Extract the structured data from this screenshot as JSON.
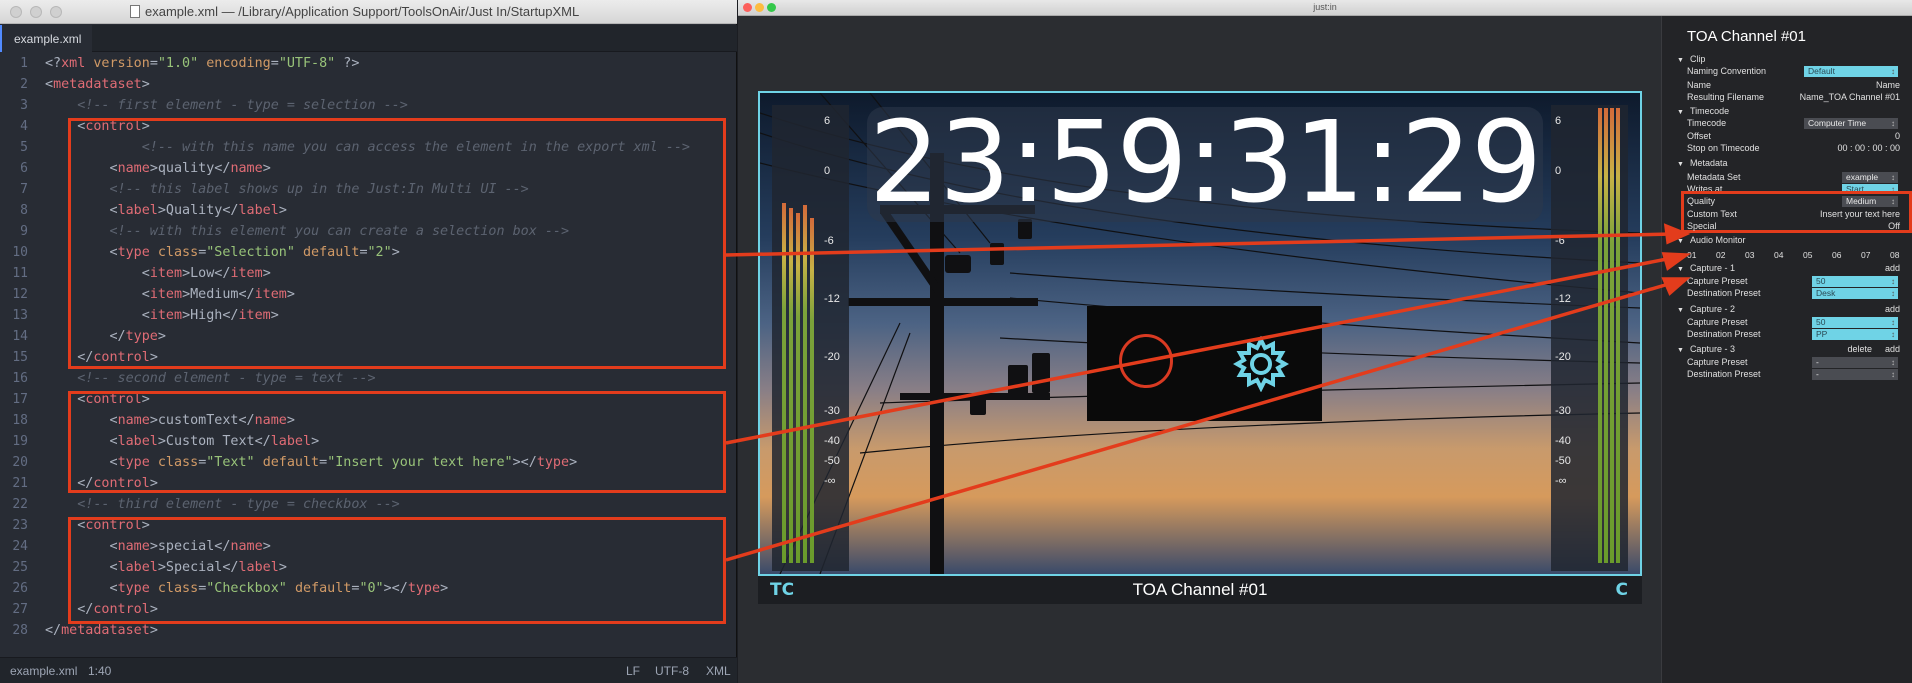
{
  "editor": {
    "window_title": "example.xml — /Library/Application Support/ToolsOnAir/Just In/StartupXML",
    "tab": "example.xml",
    "lines": [
      {
        "n": "1",
        "parts": [
          [
            "pn",
            "<?"
          ],
          [
            "tg",
            "xml"
          ],
          [
            "pn",
            " "
          ],
          [
            "at",
            "version"
          ],
          [
            "pn",
            "="
          ],
          [
            "st",
            "\"1.0\""
          ],
          [
            "pn",
            " "
          ],
          [
            "at",
            "encoding"
          ],
          [
            "pn",
            "="
          ],
          [
            "st",
            "\"UTF-8\""
          ],
          [
            "pn",
            " ?>"
          ]
        ]
      },
      {
        "n": "2",
        "parts": [
          [
            "pn",
            "<"
          ],
          [
            "tg",
            "metadataset"
          ],
          [
            "pn",
            ">"
          ]
        ]
      },
      {
        "n": "3",
        "parts": [
          [
            "cm",
            "    <!-- first element - type = selection -->"
          ]
        ]
      },
      {
        "n": "4",
        "parts": [
          [
            "pn",
            "    <"
          ],
          [
            "tg",
            "control"
          ],
          [
            "pn",
            ">"
          ]
        ]
      },
      {
        "n": "5",
        "parts": [
          [
            "cm",
            "            <!-- with this name you can access the element in the export xml -->"
          ]
        ]
      },
      {
        "n": "6",
        "parts": [
          [
            "pn",
            "        <"
          ],
          [
            "tg",
            "name"
          ],
          [
            "pn",
            ">quality</"
          ],
          [
            "tg",
            "name"
          ],
          [
            "pn",
            ">"
          ]
        ]
      },
      {
        "n": "7",
        "parts": [
          [
            "cm",
            "        <!-- this label shows up in the Just:In Multi UI -->"
          ]
        ]
      },
      {
        "n": "8",
        "parts": [
          [
            "pn",
            "        <"
          ],
          [
            "tg",
            "label"
          ],
          [
            "pn",
            ">Quality</"
          ],
          [
            "tg",
            "label"
          ],
          [
            "pn",
            ">"
          ]
        ]
      },
      {
        "n": "9",
        "parts": [
          [
            "cm",
            "        <!-- with this element you can create a selection box -->"
          ]
        ]
      },
      {
        "n": "10",
        "parts": [
          [
            "pn",
            "        <"
          ],
          [
            "tg",
            "type"
          ],
          [
            "pn",
            " "
          ],
          [
            "at",
            "class"
          ],
          [
            "pn",
            "="
          ],
          [
            "st",
            "\"Selection\""
          ],
          [
            "pn",
            " "
          ],
          [
            "at",
            "default"
          ],
          [
            "pn",
            "="
          ],
          [
            "st",
            "\"2\""
          ],
          [
            "pn",
            ">"
          ]
        ]
      },
      {
        "n": "11",
        "parts": [
          [
            "pn",
            "            <"
          ],
          [
            "tg",
            "item"
          ],
          [
            "pn",
            ">Low</"
          ],
          [
            "tg",
            "item"
          ],
          [
            "pn",
            ">"
          ]
        ]
      },
      {
        "n": "12",
        "parts": [
          [
            "pn",
            "            <"
          ],
          [
            "tg",
            "item"
          ],
          [
            "pn",
            ">Medium</"
          ],
          [
            "tg",
            "item"
          ],
          [
            "pn",
            ">"
          ]
        ]
      },
      {
        "n": "13",
        "parts": [
          [
            "pn",
            "            <"
          ],
          [
            "tg",
            "item"
          ],
          [
            "pn",
            ">High</"
          ],
          [
            "tg",
            "item"
          ],
          [
            "pn",
            ">"
          ]
        ]
      },
      {
        "n": "14",
        "parts": [
          [
            "pn",
            "        </"
          ],
          [
            "tg",
            "type"
          ],
          [
            "pn",
            ">"
          ]
        ]
      },
      {
        "n": "15",
        "parts": [
          [
            "pn",
            "    </"
          ],
          [
            "tg",
            "control"
          ],
          [
            "pn",
            ">"
          ]
        ]
      },
      {
        "n": "16",
        "parts": [
          [
            "cm",
            "    <!-- second element - type = text -->"
          ]
        ]
      },
      {
        "n": "17",
        "parts": [
          [
            "pn",
            "    <"
          ],
          [
            "tg",
            "control"
          ],
          [
            "pn",
            ">"
          ]
        ]
      },
      {
        "n": "18",
        "parts": [
          [
            "pn",
            "        <"
          ],
          [
            "tg",
            "name"
          ],
          [
            "pn",
            ">customText</"
          ],
          [
            "tg",
            "name"
          ],
          [
            "pn",
            ">"
          ]
        ]
      },
      {
        "n": "19",
        "parts": [
          [
            "pn",
            "        <"
          ],
          [
            "tg",
            "label"
          ],
          [
            "pn",
            ">Custom Text</"
          ],
          [
            "tg",
            "label"
          ],
          [
            "pn",
            ">"
          ]
        ]
      },
      {
        "n": "20",
        "parts": [
          [
            "pn",
            "        <"
          ],
          [
            "tg",
            "type"
          ],
          [
            "pn",
            " "
          ],
          [
            "at",
            "class"
          ],
          [
            "pn",
            "="
          ],
          [
            "st",
            "\"Text\""
          ],
          [
            "pn",
            " "
          ],
          [
            "at",
            "default"
          ],
          [
            "pn",
            "="
          ],
          [
            "st",
            "\"Insert your text here\""
          ],
          [
            "pn",
            "></"
          ],
          [
            "tg",
            "type"
          ],
          [
            "pn",
            ">"
          ]
        ]
      },
      {
        "n": "21",
        "parts": [
          [
            "pn",
            "    </"
          ],
          [
            "tg",
            "control"
          ],
          [
            "pn",
            ">"
          ]
        ]
      },
      {
        "n": "22",
        "parts": [
          [
            "cm",
            "    <!-- third element - type = checkbox -->"
          ]
        ]
      },
      {
        "n": "23",
        "parts": [
          [
            "pn",
            "    <"
          ],
          [
            "tg",
            "control"
          ],
          [
            "pn",
            ">"
          ]
        ]
      },
      {
        "n": "24",
        "parts": [
          [
            "pn",
            "        <"
          ],
          [
            "tg",
            "name"
          ],
          [
            "pn",
            ">special</"
          ],
          [
            "tg",
            "name"
          ],
          [
            "pn",
            ">"
          ]
        ]
      },
      {
        "n": "25",
        "parts": [
          [
            "pn",
            "        <"
          ],
          [
            "tg",
            "label"
          ],
          [
            "pn",
            ">Special</"
          ],
          [
            "tg",
            "label"
          ],
          [
            "pn",
            ">"
          ]
        ]
      },
      {
        "n": "26",
        "parts": [
          [
            "pn",
            "        <"
          ],
          [
            "tg",
            "type"
          ],
          [
            "pn",
            " "
          ],
          [
            "at",
            "class"
          ],
          [
            "pn",
            "="
          ],
          [
            "st",
            "\"Checkbox\""
          ],
          [
            "pn",
            " "
          ],
          [
            "at",
            "default"
          ],
          [
            "pn",
            "="
          ],
          [
            "st",
            "\"0\""
          ],
          [
            "pn",
            "></"
          ],
          [
            "tg",
            "type"
          ],
          [
            "pn",
            ">"
          ]
        ]
      },
      {
        "n": "27",
        "parts": [
          [
            "pn",
            "    </"
          ],
          [
            "tg",
            "control"
          ],
          [
            "pn",
            ">"
          ]
        ]
      },
      {
        "n": "28",
        "parts": [
          [
            "pn",
            "</"
          ],
          [
            "tg",
            "metadataset"
          ],
          [
            "pn",
            ">"
          ]
        ]
      }
    ],
    "status": {
      "file": "example.xml",
      "cursor": "1:40",
      "line_ending": "LF",
      "encoding": "UTF-8",
      "grammar": "XML"
    }
  },
  "app": {
    "window_title": "just:in",
    "timecode": "23:59:31:29",
    "caption_left": "TC",
    "caption_center": "TOA Channel #01",
    "caption_right": "C",
    "meter_scale": [
      "6",
      "0",
      "-6",
      "-12",
      "-20",
      "-30",
      "-40",
      "-50",
      "-∞"
    ]
  },
  "panel": {
    "title": "TOA Channel #01",
    "clip": {
      "header": "Clip",
      "naming_convention_label": "Naming Convention",
      "naming_convention_value": "Default",
      "name_label": "Name",
      "name_value": "Name",
      "resulting_label": "Resulting Filename",
      "resulting_value": "Name_TOA Channel #01"
    },
    "timecode": {
      "header": "Timecode",
      "timecode_label": "Timecode",
      "timecode_value": "Computer Time",
      "offset_label": "Offset",
      "offset_value": "0",
      "stop_label": "Stop on Timecode",
      "stop_value": "00 : 00 : 00 : 00"
    },
    "metadata": {
      "header": "Metadata",
      "set_label": "Metadata Set",
      "set_value": "example",
      "writes_label": "Writes at",
      "writes_value": "Start",
      "quality_label": "Quality",
      "quality_value": "Medium",
      "custom_label": "Custom Text",
      "custom_value": "Insert your text here",
      "special_label": "Special",
      "special_value": "Off"
    },
    "audio": {
      "header": "Audio Monitor",
      "channels": [
        "01",
        "02",
        "03",
        "04",
        "05",
        "06",
        "07",
        "08"
      ]
    },
    "capture1": {
      "header": "Capture - 1",
      "add": "add",
      "preset_label": "Capture Preset",
      "preset_value": "50",
      "dest_label": "Destination Preset",
      "dest_value": "Desk"
    },
    "capture2": {
      "header": "Capture - 2",
      "add": "add",
      "preset_label": "Capture Preset",
      "preset_value": "50",
      "dest_label": "Destination Preset",
      "dest_value": "PP"
    },
    "capture3": {
      "header": "Capture - 3",
      "delete": "delete",
      "add": "add",
      "preset_label": "Capture Preset",
      "preset_value": "-",
      "dest_label": "Destination Preset",
      "dest_value": "-"
    }
  },
  "colors": {
    "highlight": "#e33c1c",
    "accent": "#6fd3e6",
    "editor_bg": "#282c34"
  }
}
